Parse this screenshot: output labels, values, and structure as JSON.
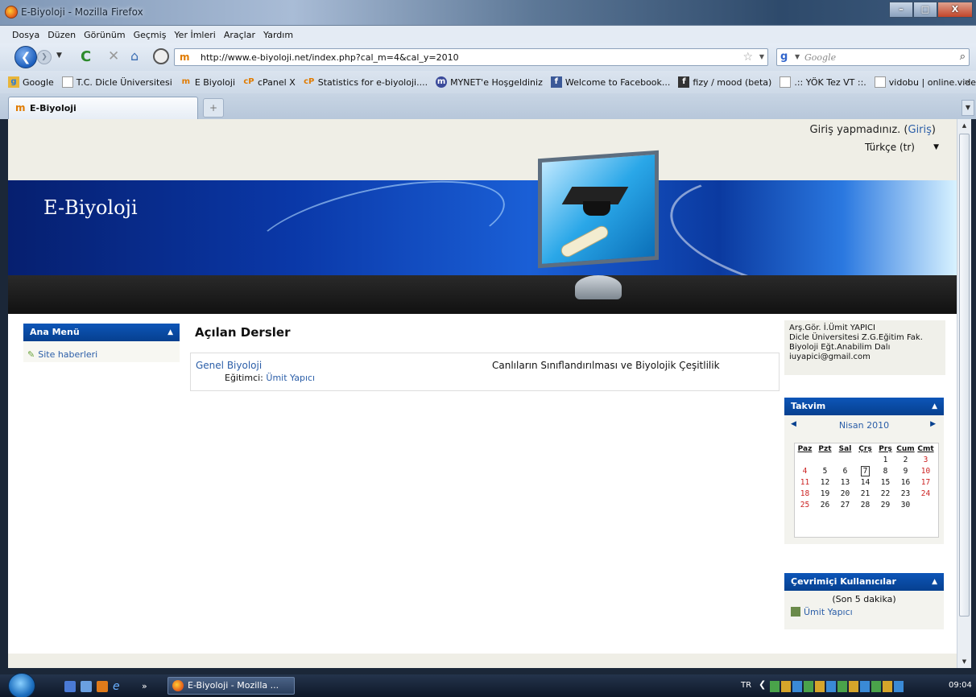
{
  "window": {
    "title": "E-Biyoloji - Mozilla Firefox",
    "buttons": {
      "minimize": "–",
      "maximize": "□",
      "close": "X"
    }
  },
  "menu": [
    "Dosya",
    "Düzen",
    "Görünüm",
    "Geçmiş",
    "Yer İmleri",
    "Araçlar",
    "Yardım"
  ],
  "nav": {
    "url": "http://www.e-biyoloji.net/index.php?cal_m=4&cal_y=2010",
    "search_placeholder": "Google"
  },
  "bookmarks": [
    "Google",
    "T.C. Dicle Üniversitesi",
    "E Biyoloji",
    "cPanel X",
    "Statistics for e-biyoloji....",
    "MYNET'e Hoşgeldiniz",
    "Welcome to Facebook...",
    "fizy / mood (beta)",
    ".:: YÖK Tez VT ::.",
    "vidobu | online.video.e..."
  ],
  "tab": {
    "label": "E-Biyoloji"
  },
  "page": {
    "login_text": "Giriş yapmadınız.",
    "login_link": "Giriş",
    "language": "Türkçe (tr)",
    "site_title": "E-Biyoloji"
  },
  "left_block": {
    "title": "Ana Menü",
    "items": [
      "Site haberleri"
    ]
  },
  "main": {
    "heading": "Açılan Dersler",
    "courses": [
      {
        "name": "Genel Biyoloji",
        "teacher_label": "Eğitimci:",
        "teacher": "Ümit Yapıcı",
        "description": "Canlıların Sınıflandırılması ve Biyolojik Çeşitlilik"
      }
    ]
  },
  "info": {
    "lines": [
      "Arş.Gör. İ.Ümit YAPICI",
      "Dicle Üniversitesi Z.G.Eğitim Fak.",
      "Biyoloji Eğt.Anabilim Dalı",
      "iuyapici@gmail.com"
    ]
  },
  "calendar": {
    "title": "Takvim",
    "month": "Nisan 2010",
    "weekdays": [
      "Paz",
      "Pzt",
      "Sal",
      "Çrş",
      "Prş",
      "Cum",
      "Cmt"
    ],
    "weeks": [
      [
        "",
        "",
        "",
        "",
        "1",
        "2",
        "3"
      ],
      [
        "4",
        "5",
        "6",
        "7",
        "8",
        "9",
        "10"
      ],
      [
        "11",
        "12",
        "13",
        "14",
        "15",
        "16",
        "17"
      ],
      [
        "18",
        "19",
        "20",
        "21",
        "22",
        "23",
        "24"
      ],
      [
        "25",
        "26",
        "27",
        "28",
        "29",
        "30",
        ""
      ]
    ],
    "today": "7",
    "weekend_color": "#cc2222"
  },
  "online": {
    "title": "Çevrimiçi Kullanıcılar",
    "period": "(Son 5 dakika)",
    "users": [
      "Ümit Yapıcı"
    ]
  },
  "taskbar": {
    "task": "E-Biyoloji - Mozilla ...",
    "lang": "TR",
    "clock": "09:04"
  },
  "colors": {
    "block_header": "#0d56b8",
    "link": "#2b5ea8",
    "page_bg": "#efeee6"
  }
}
